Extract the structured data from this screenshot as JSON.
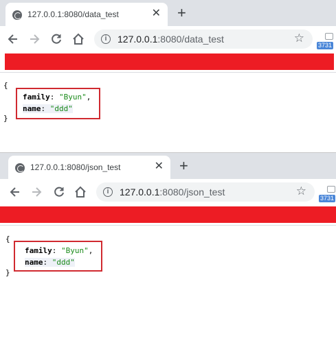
{
  "windows": [
    {
      "tab": {
        "title": "127.0.0.1:8080/data_test",
        "close": "✕"
      },
      "newtab": "+",
      "toolbar": {
        "url_host": "127.0.0.1",
        "url_path": ":8080/data_test",
        "ext_badge": "3731"
      },
      "json": {
        "open": "{",
        "close": "}",
        "family_key": "family",
        "family_value": "\"Byun\"",
        "name_key": "name",
        "name_value": "\"ddd\""
      }
    },
    {
      "tab": {
        "title": "127.0.0.1:8080/json_test",
        "close": "✕"
      },
      "newtab": "+",
      "toolbar": {
        "url_host": "127.0.0.1",
        "url_path": ":8080/json_test",
        "ext_badge": "3731"
      },
      "json": {
        "open": "{",
        "close": "}",
        "family_key": "family",
        "family_value": "\"Byun\"",
        "name_key": "name",
        "name_value": "\"ddd\""
      }
    }
  ],
  "colors": {
    "bookmark_bar_block": "#ed1c24",
    "highlight_box": "#d0292f",
    "string_value": "#1a8a1a"
  },
  "icons": [
    "globe-icon",
    "close-icon",
    "plus-icon",
    "back-arrow-icon",
    "forward-arrow-icon",
    "reload-icon",
    "home-icon",
    "info-icon",
    "star-icon",
    "extension-icon"
  ]
}
